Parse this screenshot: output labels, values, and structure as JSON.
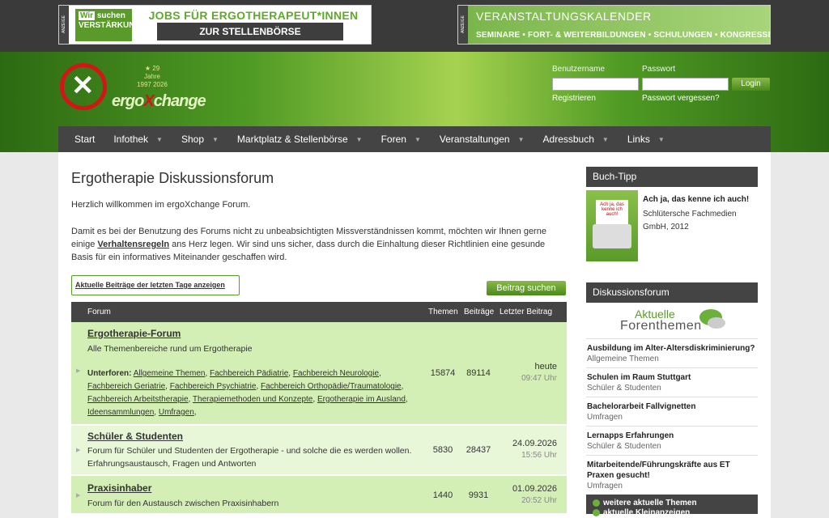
{
  "ads": {
    "left": {
      "label": "ANZEIGE",
      "logo_line1a": "Wir",
      "logo_line1b": "suchen",
      "logo_line2": "VERSTÄRKUNG",
      "headline": "JOBS FÜR ERGOTHERAPEUT*INNEN",
      "button": "ZUR STELLENBÖRSE"
    },
    "right": {
      "label": "ANZEIGE",
      "title": "VERANSTALTUNGSKALENDER",
      "subtitle": "SEMINARE • FORT- & WEITERBILDUNGEN • SCHULUNGEN • KONGRESSE"
    }
  },
  "brand": {
    "jubilee_years": "29",
    "jubilee_word": "Jahre",
    "jubilee_range": "1997  2026",
    "name_a": "ergo",
    "name_x": "X",
    "name_b": "change"
  },
  "login": {
    "username_label": "Benutzername",
    "password_label": "Passwort",
    "button": "Login",
    "register": "Registrieren",
    "forgot": "Passwort vergessen?"
  },
  "nav": [
    "Start",
    "Infothek",
    "Shop",
    "Marktplatz & Stellenbörse",
    "Foren",
    "Veranstaltungen",
    "Adressbuch",
    "Links"
  ],
  "page": {
    "title": "Ergotherapie Diskussionsforum",
    "welcome": "Herzlich willkommen im ergoXchange Forum.",
    "intro_a": "Damit es bei der Benutzung des Forums nicht zu unbeabsichtigten Missverständnissen kommt, möchten wir Ihnen gerne einige ",
    "intro_link": "Verhaltensregeln",
    "intro_b": " ans Herz legen. Wir sind uns sicher, dass durch die Einhaltung dieser Richtlinien eine gesunde Basis für ein informatives Miteinander geschaffen wird.",
    "recent_link": "Aktuelle Beiträge der letzten Tage anzeigen",
    "search_button": "Beitrag suchen"
  },
  "table": {
    "headers": {
      "forum": "Forum",
      "topics": "Themen",
      "posts": "Beiträge",
      "last": "Letzter Beitrag"
    },
    "rows": [
      {
        "title": "Ergotherapie-Forum",
        "desc": "Alle Themenbereiche rund um Ergotherapie",
        "subs_label": "Unterforen:",
        "subs": [
          "Allgemeine Themen",
          "Fachbereich Pädiatrie",
          "Fachbereich Neurologie",
          "Fachbereich Geriatrie",
          "Fachbereich Psychiatrie",
          "Fachbereich Orthopädie/Traumatologie",
          "Fachbereich Arbeitstherapie",
          "Therapiemethoden und Konzepte",
          "Ergotherapie im Ausland",
          "Ideensammlungen",
          "Umfragen"
        ],
        "topics": "15874",
        "posts": "89114",
        "date": "heute",
        "time": "09:47 Uhr"
      },
      {
        "title": "Schüler & Studenten",
        "desc": "Forum für Schüler und Studenten der Ergotherapie - und solche die es werden wollen. Erfahrungsaustausch, Fragen und Antworten",
        "topics": "5830",
        "posts": "28437",
        "date": "24.09.2026",
        "time": "15:56 Uhr"
      },
      {
        "title": "Praxisinhaber",
        "desc": "Forum für den Austausch zwischen Praxisinhabern",
        "topics": "1440",
        "posts": "9931",
        "date": "01.09.2026",
        "time": "20:52 Uhr"
      }
    ]
  },
  "sidebar": {
    "book_heading": "Buch-Tipp",
    "book_cover_text": "Ach ja, das kenne ich auch!",
    "book_title": "Ach ja, das kenne ich auch!",
    "book_publisher": "Schlütersche Fachmedien GmbH, 2012",
    "forum_heading": "Diskussionsforum",
    "logo_a": "Aktuelle",
    "logo_b": "Forenthemen",
    "topics": [
      {
        "title": "Ausbildung im Alter-Altersdiskriminierung?",
        "cat": "Allgemeine Themen"
      },
      {
        "title": "Schulen im Raum Stuttgart",
        "cat": "Schüler & Studenten"
      },
      {
        "title": "Bachelorarbeit Fallvignetten",
        "cat": "Umfragen"
      },
      {
        "title": "Lernapps Erfahrungen",
        "cat": "Schüler & Studenten"
      },
      {
        "title": "Mitarbeitende/Führungskräfte aus ET Praxen gesucht!",
        "cat": "Umfragen"
      }
    ],
    "more_topics": "weitere aktuelle Themen",
    "more_ads": "aktuelle Kleinanzeigen"
  }
}
